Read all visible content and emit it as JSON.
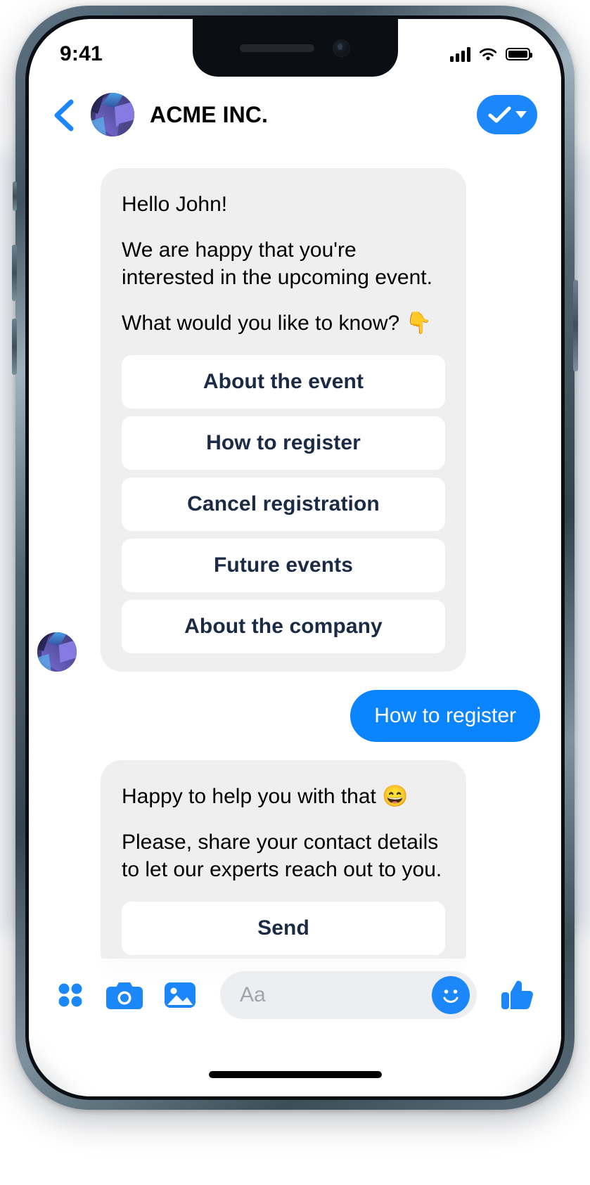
{
  "status_bar": {
    "time": "9:41",
    "signal_icon": "cellular-signal-icon",
    "wifi_icon": "wifi-icon",
    "battery_icon": "battery-full-icon"
  },
  "header": {
    "back_icon": "back-chevron-icon",
    "avatar_icon": "company-avatar",
    "title": "ACME INC.",
    "action_icon": "check-mark-icon",
    "action_caret_icon": "chevron-down-icon"
  },
  "conversation": {
    "messages": [
      {
        "sender": "bot",
        "paragraphs": [
          "Hello John!",
          "We are happy that you're interested in the upcoming event.",
          "What would you like to know? 👇"
        ],
        "quick_replies": [
          "About the event",
          "How to register",
          "Cancel registration",
          "Future events",
          "About the company"
        ]
      },
      {
        "sender": "user",
        "text": "How to register"
      },
      {
        "sender": "bot",
        "paragraphs": [
          "Happy to help you with that 😄",
          "Please, share your contact details to let our experts reach out to you."
        ],
        "quick_replies": [
          "Send"
        ]
      }
    ]
  },
  "toolbar": {
    "apps_icon": "apps-grid-icon",
    "camera_icon": "camera-icon",
    "gallery_icon": "photo-gallery-icon",
    "composer_placeholder": "Aa",
    "emoji_icon": "smiley-face-icon",
    "like_icon": "thumbs-up-icon"
  },
  "colors": {
    "accent_blue": "#1b87fb",
    "user_bubble": "#0a84ff",
    "bot_bubble": "#efefef",
    "quick_reply_text": "#1b2b46"
  }
}
